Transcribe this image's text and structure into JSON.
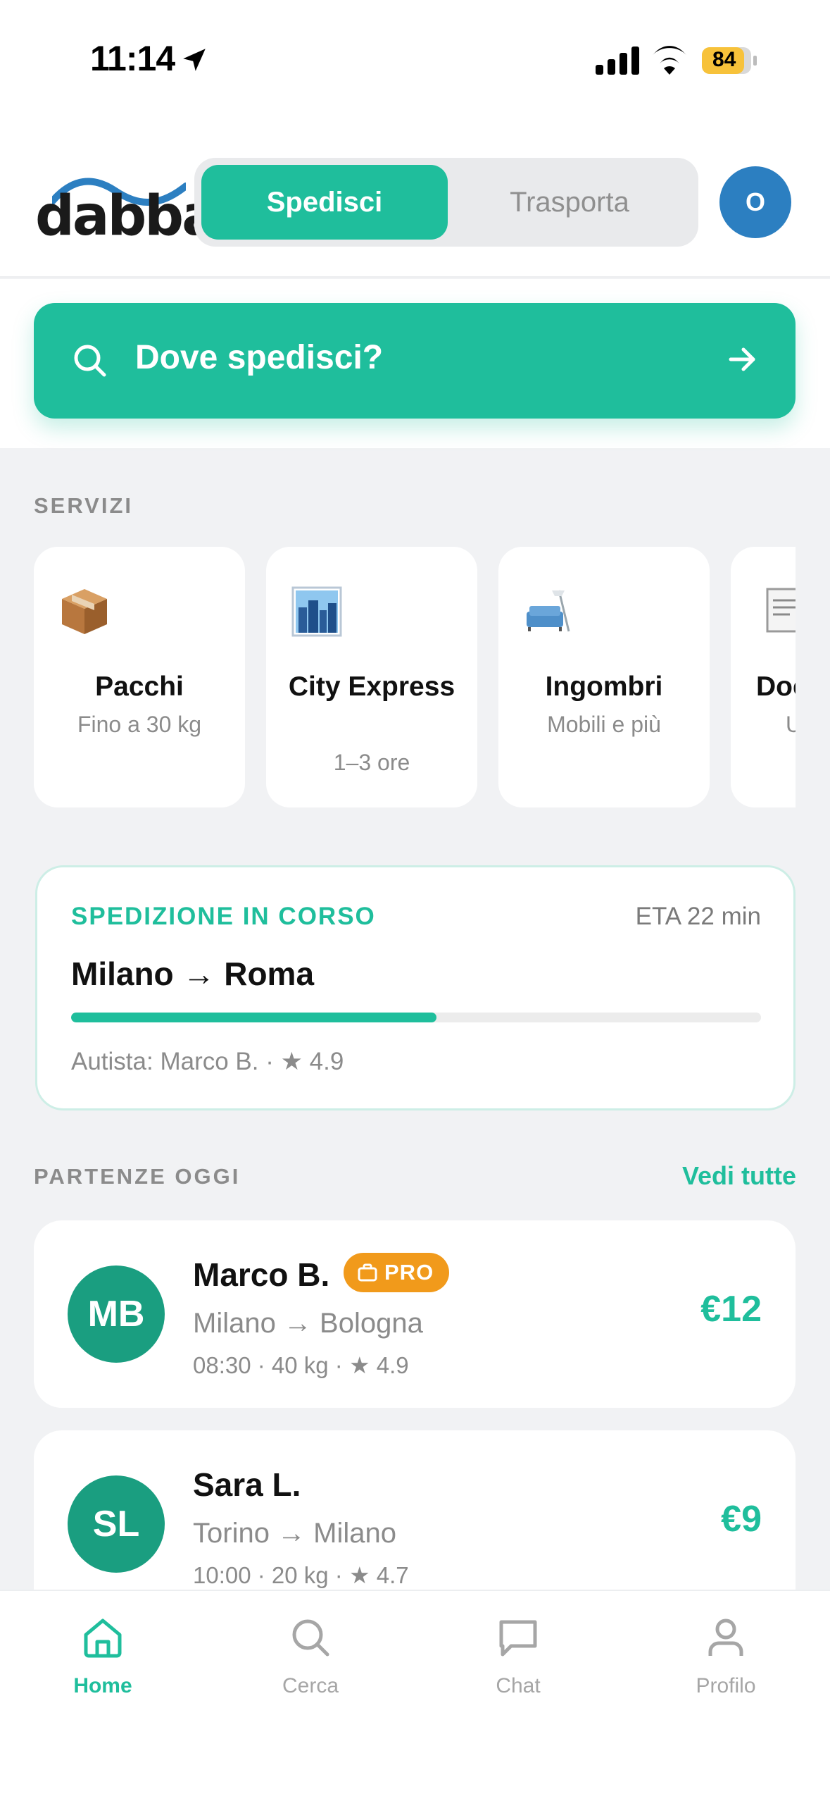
{
  "status_bar": {
    "time": "11:14",
    "battery": "84"
  },
  "header": {
    "logo_text": "dabba",
    "segments": [
      "Spedisci",
      "Trasporta"
    ],
    "active_segment": "Spedisci",
    "avatar_initial": "O"
  },
  "search": {
    "label": "Dove spedisci?"
  },
  "services": {
    "section_label": "SERVIZI",
    "items": [
      {
        "title": "Pacchi",
        "subtitle": "Fino a 30 kg",
        "icon": "package-icon"
      },
      {
        "title": "City Express",
        "subtitle": "1–3 ore",
        "icon": "cityscape-icon"
      },
      {
        "title": "Ingombri",
        "subtitle": "Mobili e più",
        "icon": "couch-lamp-icon"
      },
      {
        "title": "Doc",
        "subtitle": "U",
        "icon": "document-icon"
      }
    ]
  },
  "current_shipment": {
    "label": "SPEDIZIONE IN CORSO",
    "eta": "ETA 22 min",
    "route": "Milano → Roma",
    "progress": 0.53,
    "driver": "Autista: Marco B. · ★ 4.9"
  },
  "departures": {
    "section_label": "PARTENZE OGGI",
    "see_all": "Vedi tutte",
    "items": [
      {
        "initials": "MB",
        "name": "Marco B.",
        "badge": "PRO",
        "route": "Milano → Bologna",
        "meta": "08:30 · 40 kg · ★ 4.9",
        "price": "€12"
      },
      {
        "initials": "SL",
        "name": "Sara L.",
        "route": "Torino → Milano",
        "meta": "10:00 · 20 kg · ★ 4.7",
        "price": "€9"
      }
    ]
  },
  "tab_bar": {
    "items": [
      {
        "label": "Home",
        "icon": "home-icon",
        "active": true
      },
      {
        "label": "Cerca",
        "icon": "search-icon",
        "active": false
      },
      {
        "label": "Chat",
        "icon": "chat-icon",
        "active": false
      },
      {
        "label": "Profilo",
        "icon": "profile-icon",
        "active": false
      }
    ]
  },
  "colors": {
    "accent": "#1fbe9c",
    "avatar_blue": "#2c7fc1",
    "pro_badge": "#f19a1b"
  }
}
